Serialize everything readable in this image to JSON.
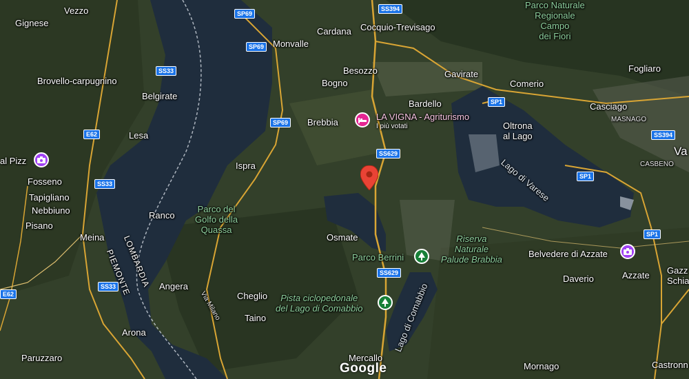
{
  "colors": {
    "land": "#33402a",
    "forest": "#263320",
    "field": "#4c5838",
    "water": "#1f2d3d",
    "road": "#d9a534",
    "shield": "#1a73e8",
    "pin": "#ea4335",
    "park_text": "#8fd19e"
  },
  "places": {
    "vezzo": "Vezzo",
    "gignese": "Gignese",
    "brovello": "Brovello-carpugnino",
    "belgirate": "Belgirate",
    "lesa": "Lesa",
    "al_pizz": "al Pizz",
    "fosseno": "Fosseno",
    "tapigliano": "Tapigliano",
    "nebbiuno": "Nebbiuno",
    "pisano": "Pisano",
    "meina": "Meina",
    "ranco": "Ranco",
    "angera": "Angera",
    "arona": "Arona",
    "paruzzaro": "Paruzzaro",
    "ispra": "Ispra",
    "monvalle": "Monvalle",
    "cardana": "Cardana",
    "cocquio": "Cocquio-Trevisago",
    "besozzo": "Besozzo",
    "bogno": "Bogno",
    "brebbia": "Brebbia",
    "gavirate": "Gavirate",
    "comerio": "Comerio",
    "bardello": "Bardello",
    "oltrona": "Oltrona\nal Lago",
    "casciago": "Casciago",
    "masnago": "MASNAGO",
    "fogliaro": "Fogliaro",
    "casbeno": "CASBENO",
    "va": "Va",
    "osmate": "Osmate",
    "cheglio": "Cheglio",
    "taino": "Taino",
    "mercallo": "Mercallo",
    "daverio": "Daverio",
    "azzate": "Azzate",
    "belvedere": "Belvedere di Azzate",
    "mornago": "Mornago",
    "castronno": "Castronn",
    "gazz": "Gazz\nSchia",
    "lombardia": "LOMBARDIA",
    "piemonte": "PIEMONTE",
    "via_milano": "Via Milano"
  },
  "green_labels": {
    "campo_dei_fiori": "Parco Naturale\nRegionale\nCampo\ndei Fiori",
    "golfo_quassa": "Parco del\nGolfo della\nQuassa",
    "parco_berrini": "Parco Berrini",
    "palude_brabbia": "Riserva\nNaturale\nPalude Brabbia",
    "pista_ciclo": "Pista ciclopedonale\ndel Lago di Comabbio"
  },
  "lakes": {
    "lago_di_varese": "Lago di Varese",
    "lago_di_comabbio": "Lago di Comabbio"
  },
  "poi": {
    "la_vigna_title": "LA VIGNA - Agriturismo",
    "la_vigna_sub": "I più votati"
  },
  "roads": {
    "sp69_a": "SP69",
    "sp69_b": "SP69",
    "sp69_c": "SP69",
    "ss394_a": "SS394",
    "ss394_b": "SS394",
    "ss33_a": "SS33",
    "ss33_b": "SS33",
    "ss33_c": "SS33",
    "e62_a": "E62",
    "e62_b": "E62",
    "sp1_a": "SP1",
    "sp1_b": "SP1",
    "sp1_c": "SP1",
    "ss629_a": "SS629",
    "ss629_b": "SS629"
  },
  "attribution": "Google"
}
